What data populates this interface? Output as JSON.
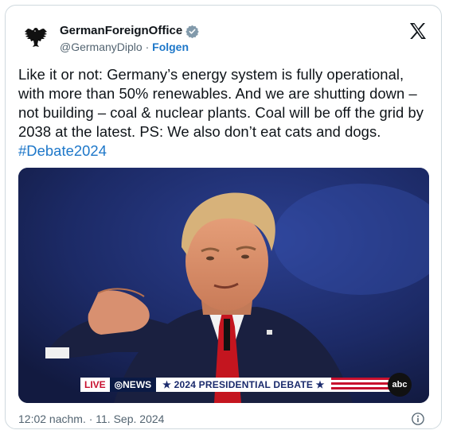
{
  "author": {
    "name": "GermanForeignOffice",
    "handle": "@GermanyDiplo",
    "separator": "·",
    "follow_label": "Folgen"
  },
  "tweet": {
    "text": "Like it or not: Germany’s energy system is fully operational, with more than 50% renewables. And we are shutting down – not building – coal & nuclear plants. Coal will be off the grid by 2038 at the latest. PS: We also don’t eat cats and dogs. ",
    "hashtag": "#Debate2024",
    "timestamp": "12:02 nachm. · 11. Sep. 2024"
  },
  "media": {
    "live": "LIVE",
    "news": "◎NEWS",
    "banner": "★ 2024 PRESIDENTIAL DEBATE ★",
    "network": "abc"
  },
  "colors": {
    "link": "#1d77c9",
    "verified": "#829aab",
    "text": "#0f1419",
    "muted": "#536471"
  },
  "icons": [
    "eagle-logo-icon",
    "verified-badge-icon",
    "x-logo-icon",
    "info-icon"
  ]
}
